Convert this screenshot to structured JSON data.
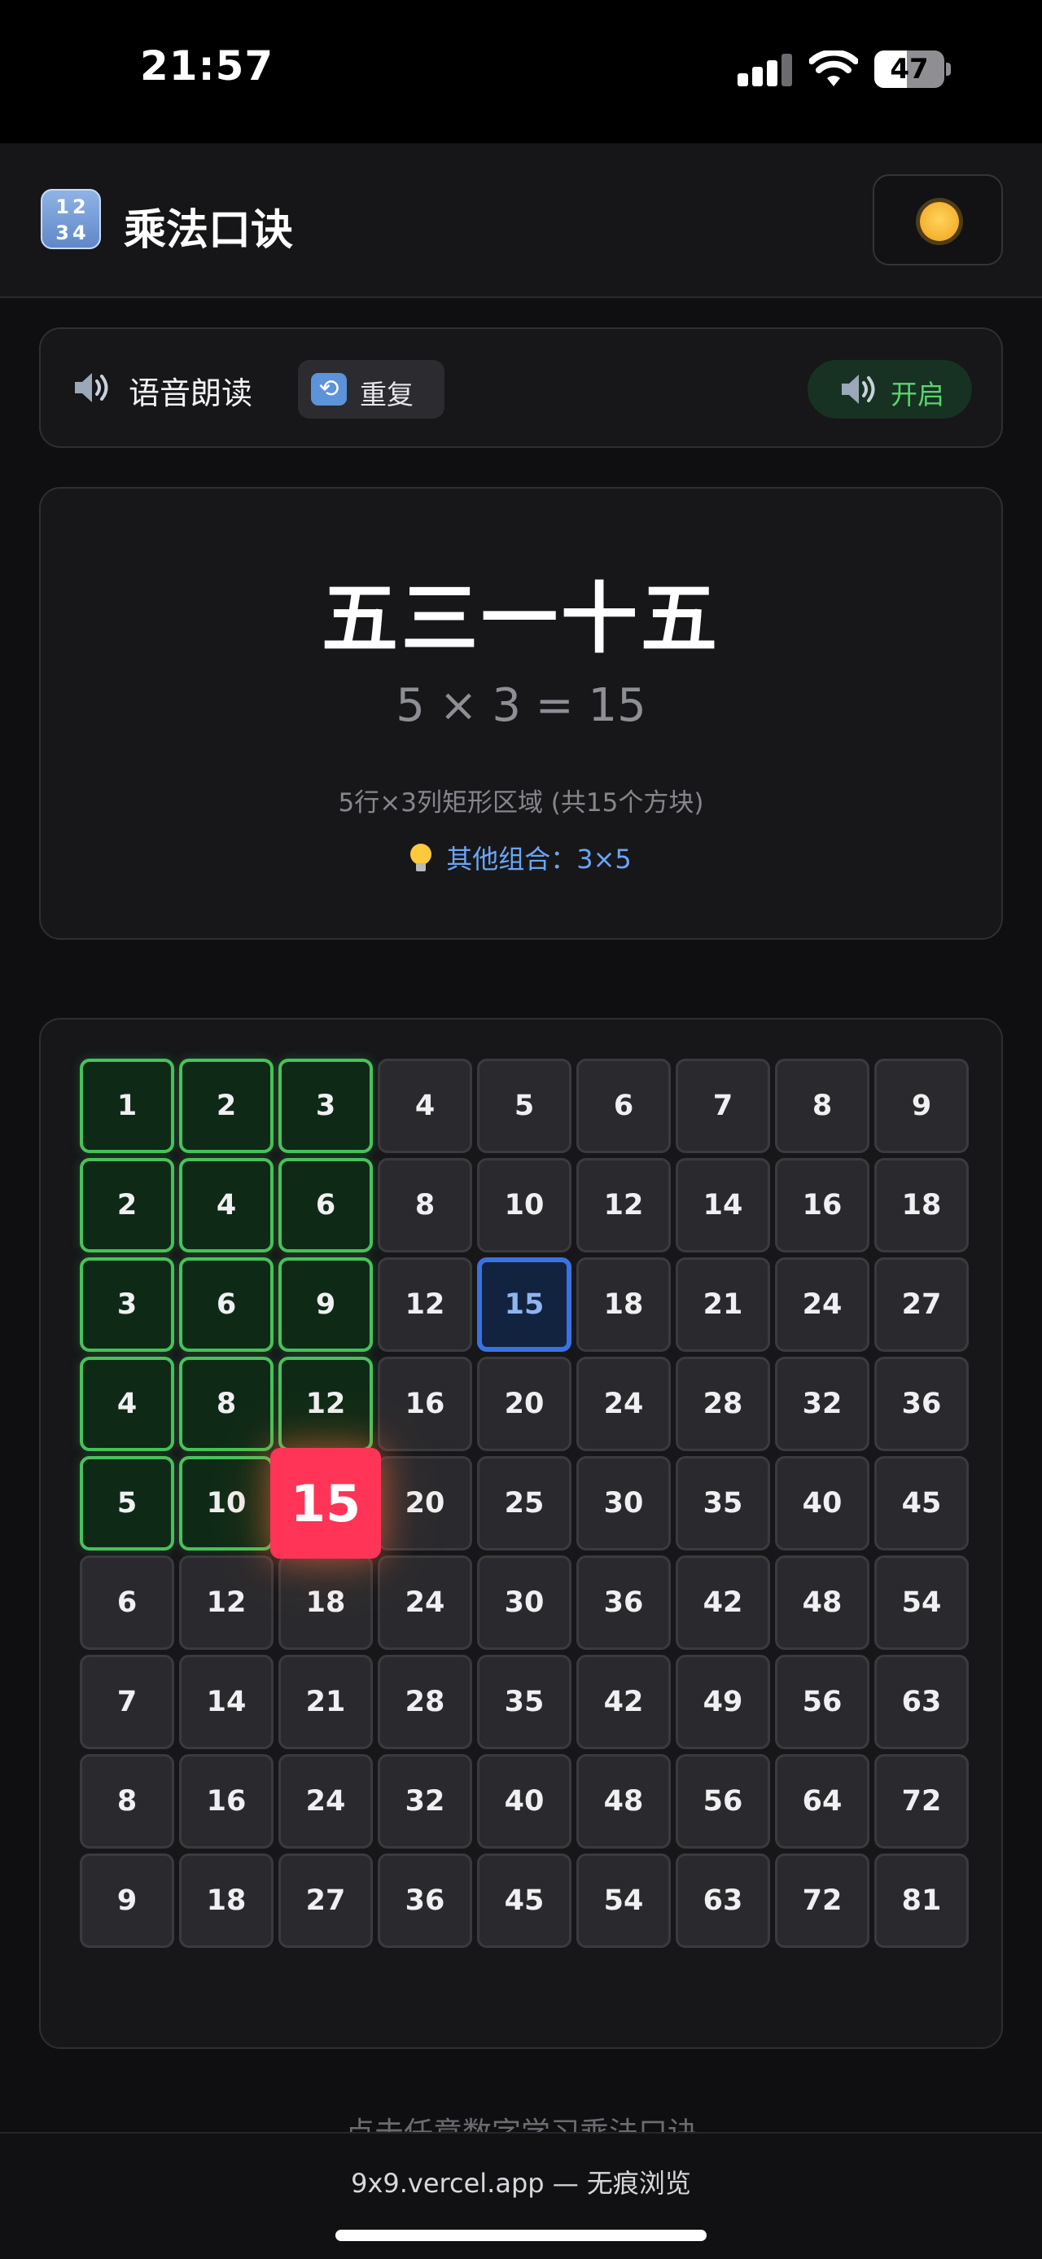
{
  "status_bar": {
    "time": "21:57",
    "battery": "47"
  },
  "header": {
    "logo": [
      "12",
      "34"
    ],
    "title": "乘法口诀"
  },
  "voice_panel": {
    "label": "语音朗读",
    "repeat_label": "重复",
    "toggle_label": "开启"
  },
  "formula": {
    "rhyme": "五三一十五",
    "equation": "5 × 3 = 15",
    "description": "5行×3列矩形区域 (共15个方块)",
    "other_combo": "其他组合：3×5"
  },
  "table": {
    "size": 9,
    "selected_row": 5,
    "selected_col": 3,
    "alternate_row": 3,
    "alternate_col": 5,
    "rows": [
      [
        1,
        2,
        3,
        4,
        5,
        6,
        7,
        8,
        9
      ],
      [
        2,
        4,
        6,
        8,
        10,
        12,
        14,
        16,
        18
      ],
      [
        3,
        6,
        9,
        12,
        15,
        18,
        21,
        24,
        27
      ],
      [
        4,
        8,
        12,
        16,
        20,
        24,
        28,
        32,
        36
      ],
      [
        5,
        10,
        15,
        20,
        25,
        30,
        35,
        40,
        45
      ],
      [
        6,
        12,
        18,
        24,
        30,
        36,
        42,
        48,
        54
      ],
      [
        7,
        14,
        21,
        28,
        35,
        42,
        49,
        56,
        63
      ],
      [
        8,
        16,
        24,
        32,
        40,
        48,
        56,
        64,
        72
      ],
      [
        9,
        18,
        27,
        36,
        45,
        54,
        63,
        72,
        81
      ]
    ]
  },
  "hint": "点击任意数字学习乘法口诀",
  "browser": {
    "url_text": "9x9.vercel.app — 无痕浏览"
  },
  "colors": {
    "selected": "#47c35a",
    "target": "#ff3457",
    "alternate": "#3a72e0",
    "toggle_on": "#5ad36e",
    "link": "#6aa6f2"
  },
  "icons": {
    "theme": "sun-icon",
    "voice": "speaker-icon",
    "repeat": "repeat-icon",
    "tip": "lightbulb-icon"
  }
}
